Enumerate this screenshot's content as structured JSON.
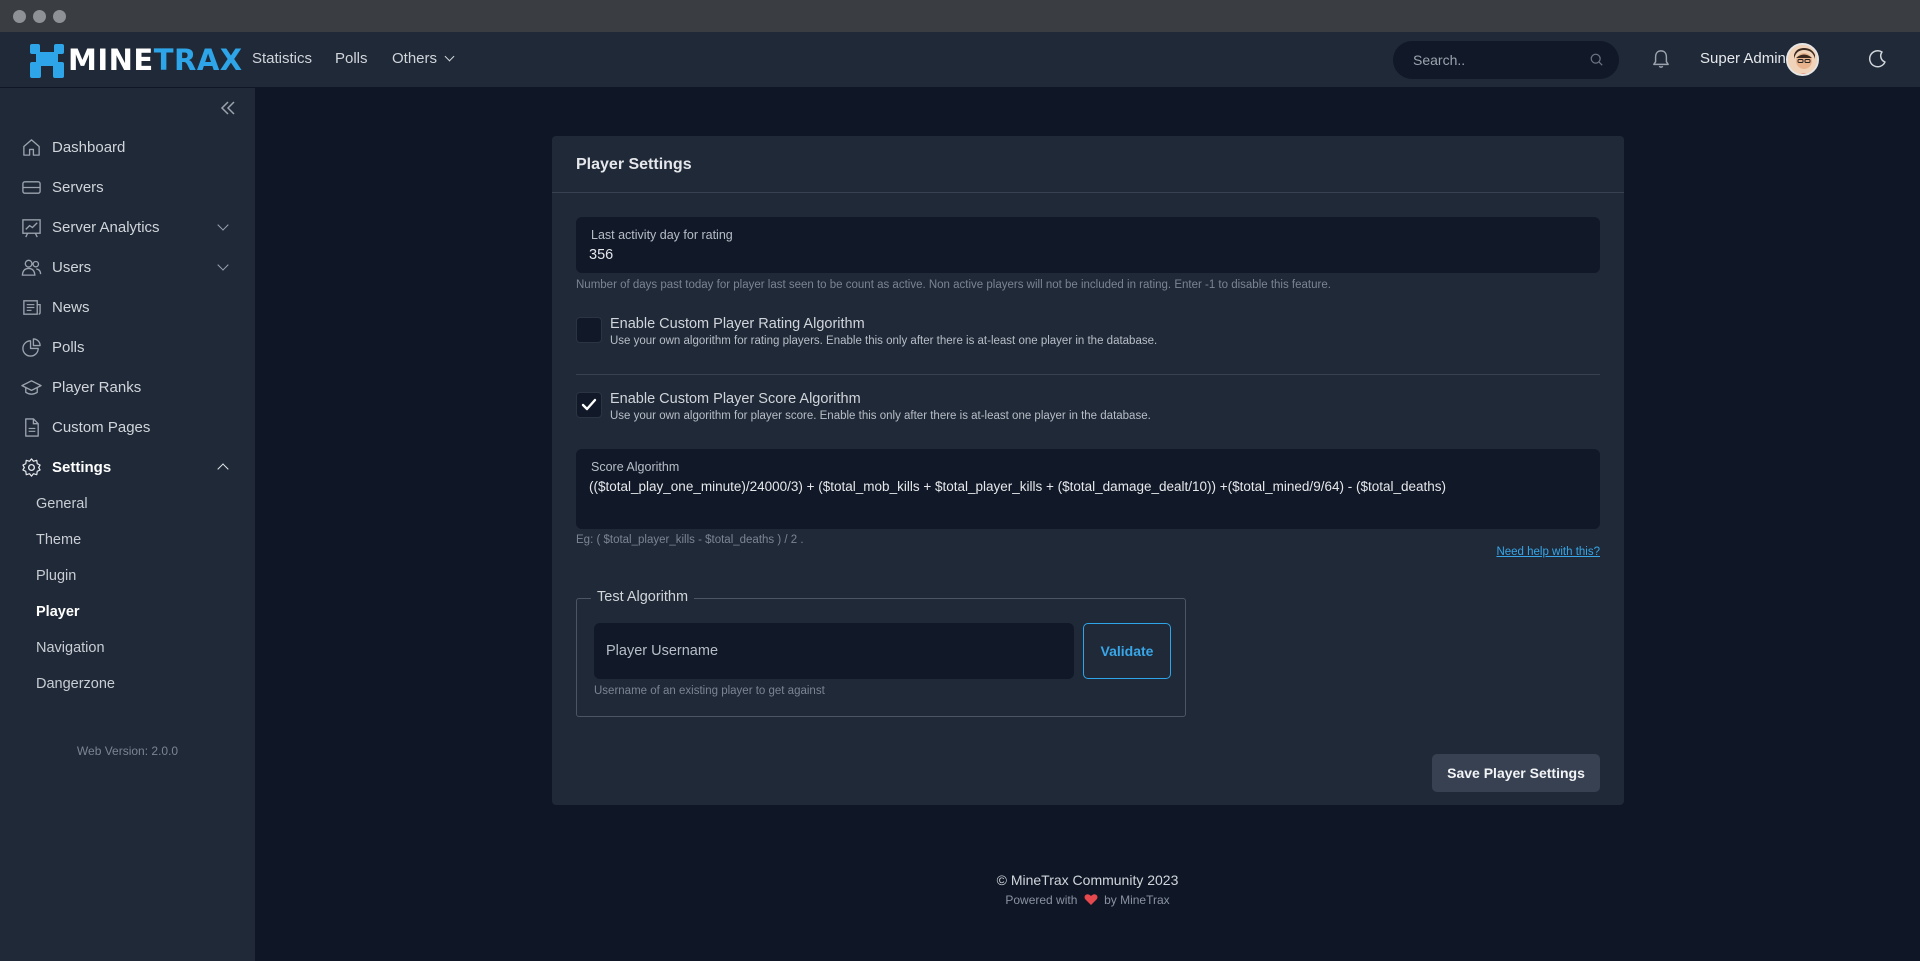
{
  "brand": {
    "logo_white": "MINE",
    "logo_blue": "TRAX",
    "accent": "#2ea5e8"
  },
  "topnav": {
    "links": [
      "Statistics",
      "Polls",
      "Others"
    ],
    "search_placeholder": "Search..",
    "user_name": "Super Admin"
  },
  "sidebar": {
    "items": [
      {
        "label": "Dashboard",
        "icon": "home-icon"
      },
      {
        "label": "Servers",
        "icon": "server-icon"
      },
      {
        "label": "Server Analytics",
        "icon": "chart-icon"
      },
      {
        "label": "Users",
        "icon": "users-icon"
      },
      {
        "label": "News",
        "icon": "news-icon"
      },
      {
        "label": "Polls",
        "icon": "pie-icon"
      },
      {
        "label": "Player Ranks",
        "icon": "graduation-cap-icon"
      },
      {
        "label": "Custom Pages",
        "icon": "document-icon"
      },
      {
        "label": "Settings",
        "icon": "gear-icon"
      }
    ],
    "settings_sub": [
      "General",
      "Theme",
      "Plugin",
      "Player",
      "Navigation",
      "Dangerzone"
    ],
    "active_sub": "Player",
    "version": "Web Version: 2.0.0"
  },
  "card": {
    "title": "Player Settings",
    "last_activity": {
      "label": "Last activity day for rating",
      "value": "356",
      "help": "Number of days past today for player last seen to be count as active. Non active players will not be included in rating. Enter -1 to disable this feature."
    },
    "rating_algo": {
      "title": "Enable Custom Player Rating Algorithm",
      "desc": "Use your own algorithm for rating players. Enable this only after there is at-least one player in the database.",
      "checked": false
    },
    "score_algo": {
      "title": "Enable Custom Player Score Algorithm",
      "desc": "Use your own algorithm for player score. Enable this only after there is at-least one player in the database.",
      "checked": true
    },
    "score_field": {
      "label": "Score Algorithm",
      "value": "(($total_play_one_minute)/24000/3) + ($total_mob_kills + $total_player_kills + ($total_damage_dealt/10)) +($total_mined/9/64) - ($total_deaths)",
      "example": "Eg: ( $total_player_kills - $total_deaths ) / 2 .",
      "help_link": "Need help with this?"
    },
    "test": {
      "legend": "Test Algorithm",
      "input_placeholder": "Player Username",
      "validate_label": "Validate",
      "help": "Username of an existing player to get against"
    },
    "save_label": "Save Player Settings"
  },
  "footer": {
    "copyright": "© MineTrax Community 2023",
    "powered_prefix": "Powered with",
    "powered_suffix": "by MineTrax"
  }
}
